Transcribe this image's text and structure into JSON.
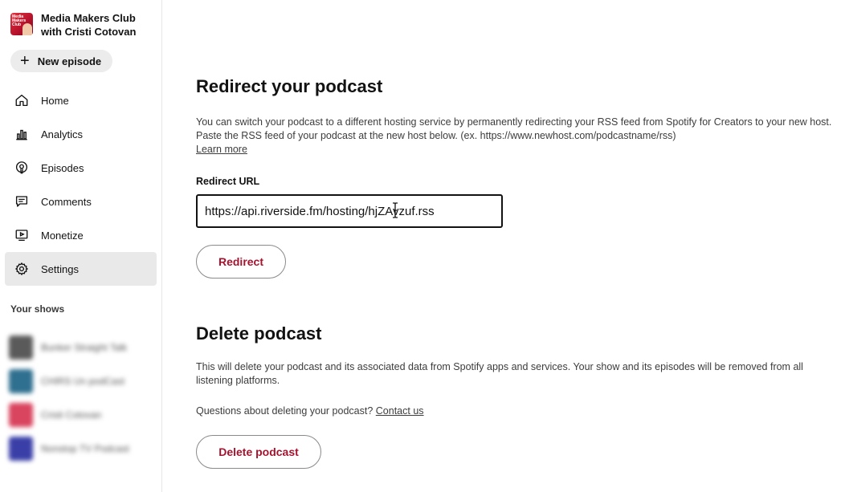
{
  "sidebar": {
    "show": {
      "title": "Media Makers Club with Cristi Cotovan",
      "art_text": "Media Makers Club"
    },
    "new_episode_label": "New episode",
    "nav": [
      {
        "label": "Home",
        "icon": "home-icon"
      },
      {
        "label": "Analytics",
        "icon": "analytics-icon"
      },
      {
        "label": "Episodes",
        "icon": "episodes-icon"
      },
      {
        "label": "Comments",
        "icon": "comments-icon"
      },
      {
        "label": "Monetize",
        "icon": "monetize-icon"
      },
      {
        "label": "Settings",
        "icon": "gear-icon",
        "active": true
      }
    ],
    "your_shows_label": "Your shows",
    "shows": [
      {
        "name": "Bunker Straight Talk",
        "color": "#5a5a5a"
      },
      {
        "name": "CHIRS Un podCast",
        "color": "#2f6f8f"
      },
      {
        "name": "Cristi Cotovan",
        "color": "#d9445e"
      },
      {
        "name": "Nonstop TV Podcast",
        "color": "#3a3fa8"
      }
    ]
  },
  "redirect": {
    "title": "Redirect your podcast",
    "description_line1": "You can switch your podcast to a different hosting service by permanently redirecting your RSS feed from Spotify for Creators to your new host.",
    "description_line2": "Paste the RSS feed of your podcast at the new host below. (ex. https://www.newhost.com/podcastname/rss)",
    "learn_more": "Learn more",
    "field_label": "Redirect URL",
    "url_value": "https://api.riverside.fm/hosting/hjZAvzuf.rss",
    "button_label": "Redirect"
  },
  "delete": {
    "title": "Delete podcast",
    "description": "This will delete your podcast and its associated data from Spotify apps and services. Your show and its episodes will be removed from all listening platforms.",
    "question": "Questions about deleting your podcast?",
    "contact_link": "Contact us",
    "button_label": "Delete podcast"
  },
  "colors": {
    "accent_red": "#a6132e",
    "active_nav_bg": "#e9e9e9"
  }
}
